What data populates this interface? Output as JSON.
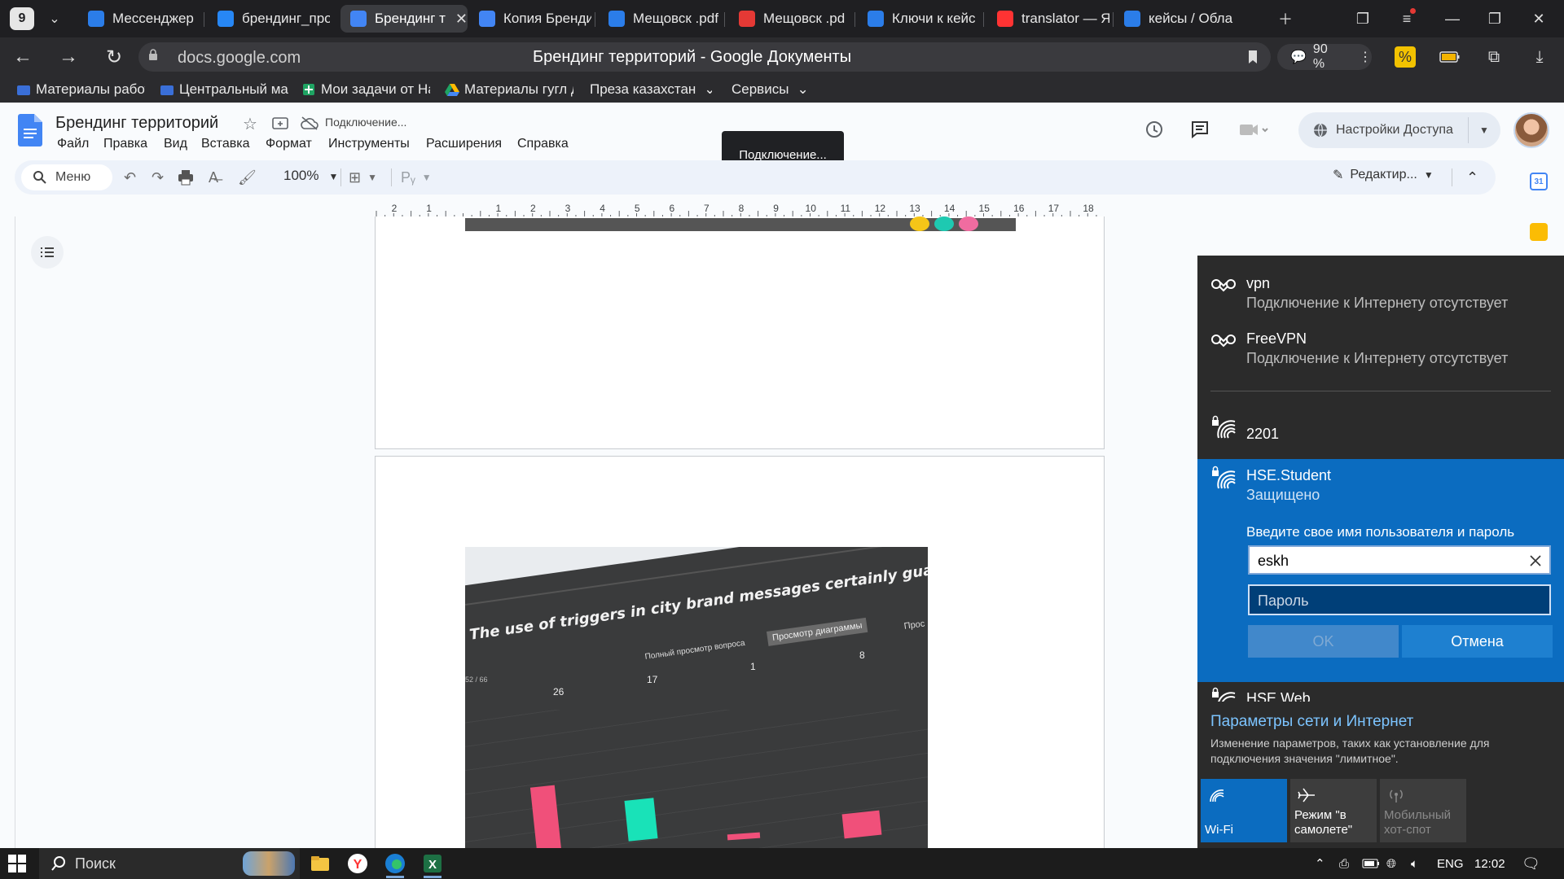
{
  "browser": {
    "tab_count": "9",
    "tabs": [
      {
        "title": "Мессенджер",
        "icon": "messenger-icon",
        "color": "#2b7de9"
      },
      {
        "title": "брендинг_про",
        "icon": "vk-icon",
        "color": "#2787f5"
      },
      {
        "title": "Брендинг т",
        "icon": "google-docs-icon",
        "color": "#4285f4",
        "active": true
      },
      {
        "title": "Копия Бренди",
        "icon": "google-docs-icon",
        "color": "#4285f4"
      },
      {
        "title": "Мещовск .pdf",
        "icon": "document-icon",
        "color": "#2b7de9"
      },
      {
        "title": "Мещовск .pd",
        "icon": "pdf-icon",
        "color": "#e53935"
      },
      {
        "title": "Ключи к кейс",
        "icon": "document-icon",
        "color": "#2b7de9"
      },
      {
        "title": "translator — Я",
        "icon": "yandex-icon",
        "color": "#f33"
      },
      {
        "title": "кейсы / Обла",
        "icon": "yandex-cloud-icon",
        "color": "#2b7de9"
      }
    ],
    "address": {
      "url": "docs.google.com",
      "page_title": "Брендинг территорий - Google Документы"
    },
    "zoom": "90 %",
    "bookmarks": [
      "Материалы работ",
      "Центральный ма",
      "Мои задачи от На",
      "Материалы гугл д",
      "Преза казахстан",
      "Сервисы"
    ]
  },
  "docs": {
    "title": "Брендинг территорий",
    "save_status": "Подключение...",
    "menu": [
      "Файл",
      "Правка",
      "Вид",
      "Вставка",
      "Формат",
      "Инструменты",
      "Расширения",
      "Справка"
    ],
    "share_label": "Настройки Доступа",
    "toolbar": {
      "search_label": "Меню",
      "zoom": "100%",
      "mode_label": "Редактир..."
    },
    "tooltip": "Подключение...",
    "ruler_ticks": [
      "2",
      "1",
      "",
      "1",
      "2",
      "3",
      "4",
      "5",
      "6",
      "7",
      "8",
      "9",
      "10",
      "11",
      "12",
      "13",
      "14",
      "15",
      "16",
      "17",
      "18"
    ],
    "photo": {
      "headline": "The use of triggers in city brand messages certainly guarantee",
      "col_full": "Полный просмотр вопроса",
      "col_chart": "Просмотр диаграммы",
      "col_more": "Прос",
      "counter": "52 / 66",
      "values": [
        "26",
        "17",
        "1",
        "8"
      ]
    }
  },
  "wifi": {
    "networks": [
      {
        "name": "vpn",
        "status": "Подключение к Интернету отсутствует"
      },
      {
        "name": "FreeVPN",
        "status": "Подключение к Интернету отсутствует"
      },
      {
        "name": "2201",
        "status": ""
      }
    ],
    "selected": {
      "name": "HSE.Student",
      "status": "Защищено",
      "prompt": "Введите свое имя пользователя и пароль",
      "username": "eskh",
      "password_placeholder": "Пароль",
      "ok_label": "OK",
      "cancel_label": "Отмена"
    },
    "next_network_partial": "HSE.Web",
    "settings_title": "Параметры сети и Интернет",
    "settings_desc": "Изменение параметров, таких как установление для подключения значения \"лимитное\".",
    "quick_actions": [
      {
        "label": "Wi-Fi",
        "active": true
      },
      {
        "label": "Режим \"в самолете\"",
        "active": false
      },
      {
        "label": "Мобильный хот-спот",
        "active": false
      }
    ],
    "accent": "#0b6cc0"
  },
  "taskbar": {
    "search_label": "Поиск",
    "language": "ENG",
    "time": "12:02"
  }
}
